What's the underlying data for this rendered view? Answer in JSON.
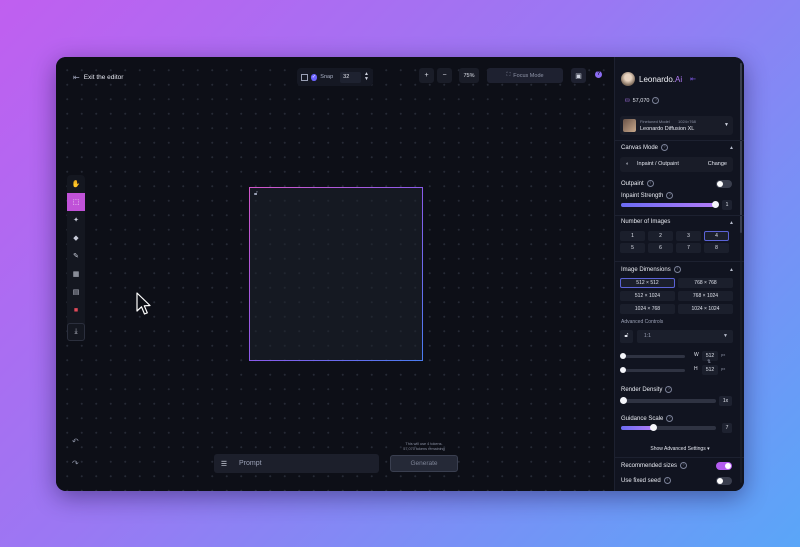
{
  "editor": {
    "exit_label": "Exit the editor",
    "snap_label": "Snap",
    "snap_value": "32",
    "zoom_in": "+",
    "zoom_out": "−",
    "zoom_level": "75%",
    "focus_mode": "Focus Mode"
  },
  "prompt": {
    "placeholder": "Prompt",
    "generate_label": "Generate",
    "tokens_line1": "This will use 4 tokens.",
    "tokens_line2": "57,070 tokens remaining"
  },
  "panel": {
    "brand": "Leonardo.",
    "brand_accent": "Ai",
    "token_count": "57,070",
    "model_caption": "Finetuned Model",
    "model_size": "1024×768",
    "model_name": "Leonardo Diffusion XL",
    "canvas_mode_title": "Canvas Mode",
    "canvas_mode_value": "Inpaint / Outpaint",
    "change_label": "Change",
    "outpaint_label": "Outpaint",
    "outpaint_on": false,
    "inpaint_strength_label": "Inpaint Strength",
    "inpaint_strength_value": "1",
    "inpaint_strength_fraction": 1.0,
    "num_images_title": "Number of Images",
    "num_images_options": [
      "1",
      "2",
      "3",
      "4",
      "5",
      "6",
      "7",
      "8"
    ],
    "num_images_selected": "4",
    "image_dim_title": "Image Dimensions",
    "dimension_options": [
      "512 × 512",
      "768 × 768",
      "512 × 1024",
      "768 × 1024",
      "1024 × 768",
      "1024 × 1024"
    ],
    "dimension_selected": "512 × 512",
    "advanced_controls_label": "Advanced Controls",
    "ratio_value": "1:1",
    "width_label": "W",
    "width_value": "512",
    "height_label": "H",
    "height_value": "512",
    "px_unit": "px",
    "render_density_label": "Render Density",
    "render_density_value": "1x",
    "guidance_scale_label": "Guidance Scale",
    "guidance_scale_value": "7",
    "guidance_fraction": 0.35,
    "show_advanced_label": "Show Advanced Settings",
    "recommended_sizes_label": "Recommended sizes",
    "recommended_sizes_on": true,
    "fixed_seed_label": "Use fixed seed",
    "fixed_seed_on": false
  },
  "colors": {
    "accent": "#b37cf6",
    "active_tool": "#c052d8",
    "background_gradient_start": "#c05ff0",
    "background_gradient_end": "#5aa6f8"
  }
}
